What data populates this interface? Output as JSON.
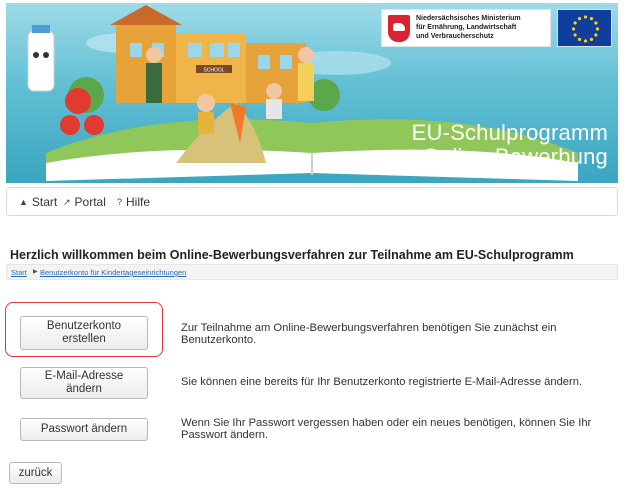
{
  "header": {
    "ministry_lines": [
      "Niedersächsisches Ministerium",
      "für Ernährung, Landwirtschaft",
      "und Verbraucherschutz"
    ],
    "title_lines": [
      "EU-Schulprogramm",
      "Online-Bewerbung"
    ],
    "school_sign": "SCHOOL"
  },
  "nav": {
    "items": [
      {
        "label": "Start",
        "icon": "home-icon"
      },
      {
        "label": "Portal",
        "icon": "link-icon"
      },
      {
        "label": "Hilfe",
        "icon": "question-icon"
      }
    ]
  },
  "main": {
    "title": "Herzlich willkommen beim Online-Bewerbungsverfahren zur Teilnahme am EU-Schulprogramm",
    "breadcrumb": {
      "start": "Start",
      "current": "Benutzerkonto für Kindertageseinrichtungen"
    },
    "actions": [
      {
        "button": "Benutzerkonto erstellen",
        "description": "Zur Teilnahme am Online-Bewerbungsverfahren benötigen Sie zunächst ein Benutzerkonto."
      },
      {
        "button": "E-Mail-Adresse ändern",
        "description": "Sie können eine bereits für Ihr Benutzerkonto registrierte E-Mail-Adresse ändern."
      },
      {
        "button": "Passwort ändern",
        "description": "Wenn Sie Ihr Passwort vergessen haben oder ein neues benötigen, können Sie Ihr Passwort ändern."
      }
    ],
    "back_button": "zurück"
  },
  "colors": {
    "highlight": "#e5353b",
    "link": "#2a6db0",
    "banner_sky": "#62bfd4",
    "eu_blue": "#0f3e9c"
  }
}
